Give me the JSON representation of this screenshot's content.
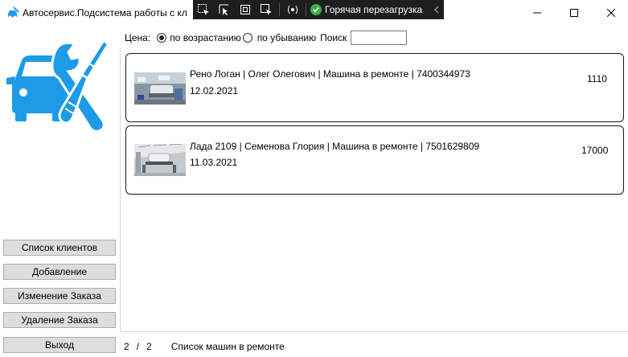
{
  "window": {
    "title": "Автосервис.Подсистема работы с кл"
  },
  "debug_toolbar": {
    "hot_reload_label": "Горячая перезагрузка"
  },
  "filter": {
    "price_label": "Цена:",
    "ascending_label": "по возрастанию",
    "descending_label": "по убыванию",
    "search_label": "Поиск",
    "search_value": "",
    "selected": "ascending"
  },
  "orders": [
    {
      "details": "Рено Логан | Олег Олегович | Машина в ремонте | 7400344973",
      "date": "12.02.2021",
      "price": "1110"
    },
    {
      "details": "Лада 2109 | Семенова Глория | Машина в ремонте | 7501629809",
      "date": "11.03.2021",
      "price": "17000"
    }
  ],
  "sidebar": {
    "buttons": [
      {
        "label": "Список клиентов"
      },
      {
        "label": "Добавление"
      },
      {
        "label": "Изменение Заказа"
      },
      {
        "label": "Удаление Заказа"
      },
      {
        "label": "Выход"
      }
    ]
  },
  "footer": {
    "shown_count": "2",
    "separator": "/",
    "total_count": "2",
    "caption": "Список машин в ремонте"
  },
  "colors": {
    "brand_blue": "#1e9be6",
    "button_bg": "#dddddd",
    "debug_bar": "#1e1e1e",
    "reload_check": "#3fae49"
  }
}
